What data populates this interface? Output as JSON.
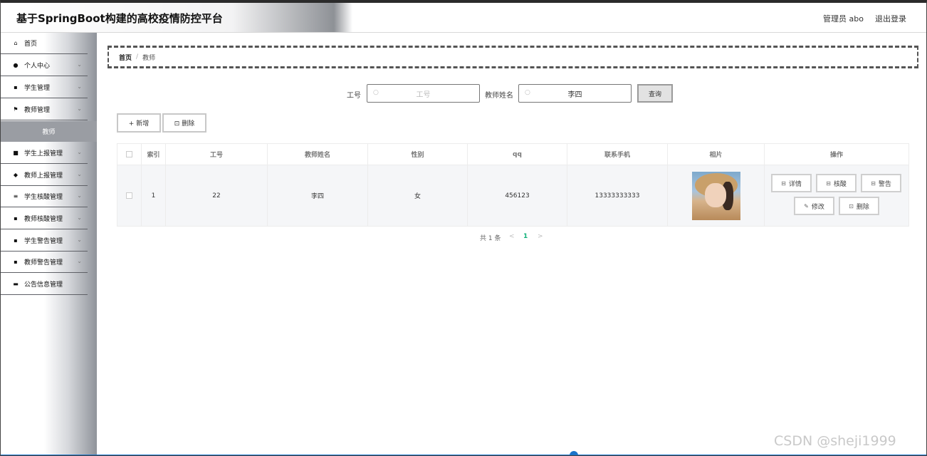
{
  "header": {
    "title": "基于SpringBoot构建的高校疫情防控平台",
    "user": "管理员 abo",
    "logout": "退出登录"
  },
  "sidebar": {
    "items": [
      {
        "label": "首页",
        "icon": "home-icon",
        "glyph": "⌂"
      },
      {
        "label": "个人中心",
        "icon": "user-icon",
        "glyph": "●"
      },
      {
        "label": "学生管理",
        "icon": "grid-icon",
        "glyph": "▪"
      },
      {
        "label": "教师管理",
        "icon": "flag-icon",
        "glyph": "⚑"
      },
      {
        "label": "学生上报管理",
        "icon": "chart-icon",
        "glyph": "■"
      },
      {
        "label": "教师上报管理",
        "icon": "pin-icon",
        "glyph": "◆"
      },
      {
        "label": "学生核酸管理",
        "icon": "list-icon",
        "glyph": "≡"
      },
      {
        "label": "教师核酸管理",
        "icon": "grid-icon",
        "glyph": "▪"
      },
      {
        "label": "学生警告管理",
        "icon": "grid-icon",
        "glyph": "▪"
      },
      {
        "label": "教师警告管理",
        "icon": "grid-icon",
        "glyph": "▪"
      },
      {
        "label": "公告信息管理",
        "icon": "message-icon",
        "glyph": "▬"
      }
    ],
    "sub_item": "教师",
    "chevron": "⌄"
  },
  "breadcrumb": {
    "home": "首页",
    "sep": "/",
    "current": "教师"
  },
  "search": {
    "id_label": "工号",
    "id_placeholder": "工号",
    "id_value": "",
    "name_label": "教师姓名",
    "name_value": "李四",
    "query_button": "查询"
  },
  "toolbar": {
    "add": "+ 新增",
    "delete": "⊡ 删除"
  },
  "table": {
    "headers": [
      "",
      "索引",
      "工号",
      "教师姓名",
      "性别",
      "qq",
      "联系手机",
      "相片",
      "操作"
    ],
    "rows": [
      {
        "index": "1",
        "id": "22",
        "name": "李四",
        "gender": "女",
        "qq": "456123",
        "phone": "13333333333"
      }
    ],
    "actions": {
      "detail": "详情",
      "nucleic": "核酸",
      "warning": "警告",
      "edit": "修改",
      "delete": "删除"
    }
  },
  "pagination": {
    "total": "共 1 条",
    "prev": "<",
    "current": "1",
    "next": ">"
  },
  "watermark": "CSDN @sheji1999"
}
